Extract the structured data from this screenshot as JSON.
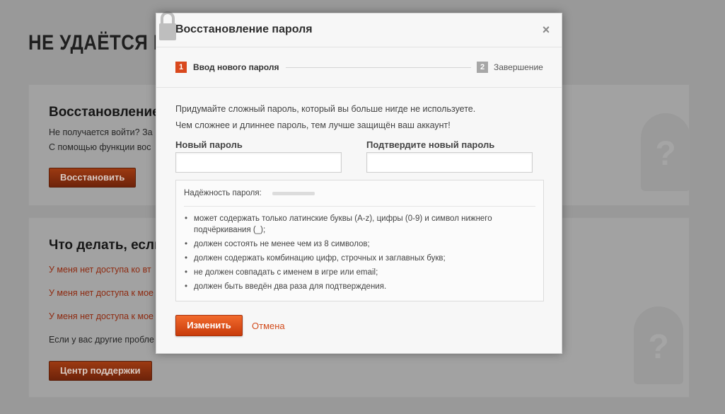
{
  "background": {
    "title": "НЕ УДАЁТСЯ ВО",
    "card1": {
      "heading": "Восстановление п",
      "line1": "Не получается войти? За",
      "line2": "С помощью функции вос",
      "button": "Восстановить"
    },
    "card2": {
      "heading": "Что делать, если..",
      "links": [
        "У меня нет доступа ко вт",
        "У меня нет доступа к мое",
        "У меня нет доступа к мое"
      ],
      "text": "Если у вас другие пробле",
      "button": "Центр поддержки"
    }
  },
  "modal": {
    "title": "Восстановление пароля",
    "close": "×",
    "steps": [
      {
        "num": "1",
        "label": "Ввод нового пароля",
        "active": true
      },
      {
        "num": "2",
        "label": "Завершение",
        "active": false
      }
    ],
    "intro1": "Придумайте сложный пароль, который вы больше нигде не используете.",
    "intro2": "Чем сложнее и длиннее пароль, тем лучше защищён ваш аккаунт!",
    "new_password_label": "Новый пароль",
    "new_password_value": "",
    "confirm_password_label": "Подтвердите новый пароль",
    "confirm_password_value": "",
    "strength_label": "Надёжность пароля:",
    "strength_level": 0,
    "rules": [
      "может содержать только латинские буквы (A-z), цифры (0-9) и символ нижнего подчёркивания (_);",
      "должен состоять не менее чем из 8 символов;",
      "должен содержать комбинацию цифр, строчных и заглавных букв;",
      "не должен совпадать с именем в игре или email;",
      "должен быть введён два раза для подтверждения."
    ],
    "submit": "Изменить",
    "cancel": "Отмена"
  },
  "colors": {
    "accent": "#d9481d",
    "link": "#d24b1c",
    "inactive_step": "#a7a7a7"
  },
  "icons": [
    "lock-icon",
    "close-icon",
    "person-silhouette-icon"
  ]
}
